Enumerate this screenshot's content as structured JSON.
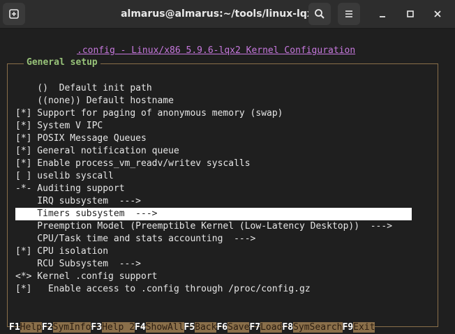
{
  "window": {
    "title": "almarus@almarus:~/tools/linux-lqx"
  },
  "icons": {
    "new_tab": "new-tab-icon",
    "search": "search-icon",
    "menu": "hamburger-menu-icon",
    "minimize": "minimize-icon",
    "maximize": "maximize-icon",
    "close": "close-icon"
  },
  "terminal": {
    "config_title": ".config - Linux/x86 5.9.6-lqx2 Kernel Configuration",
    "section_title": "General setup",
    "menu_items": [
      {
        "text": "    ()  Default init path",
        "selected": false
      },
      {
        "text": "    ((none)) Default hostname",
        "selected": false
      },
      {
        "text": "[*] Support for paging of anonymous memory (swap)",
        "selected": false
      },
      {
        "text": "[*] System V IPC",
        "selected": false
      },
      {
        "text": "[*] POSIX Message Queues",
        "selected": false
      },
      {
        "text": "[*] General notification queue",
        "selected": false
      },
      {
        "text": "[*] Enable process_vm_readv/writev syscalls",
        "selected": false
      },
      {
        "text": "[ ] uselib syscall",
        "selected": false
      },
      {
        "text": "-*- Auditing support",
        "selected": false
      },
      {
        "text": "    IRQ subsystem  --->",
        "selected": false
      },
      {
        "text": "    Timers subsystem  --->",
        "selected": true
      },
      {
        "text": "    Preemption Model (Preemptible Kernel (Low-Latency Desktop))  --->",
        "selected": false
      },
      {
        "text": "    CPU/Task time and stats accounting  --->",
        "selected": false
      },
      {
        "text": "[*] CPU isolation",
        "selected": false
      },
      {
        "text": "    RCU Subsystem  --->",
        "selected": false
      },
      {
        "text": "<*> Kernel .config support",
        "selected": false
      },
      {
        "text": "[*]   Enable access to .config through /proc/config.gz",
        "selected": false
      }
    ],
    "function_keys": [
      {
        "key": "F1",
        "label": "Help"
      },
      {
        "key": "F2",
        "label": "SymInfo"
      },
      {
        "key": "F3",
        "label": "Help 2"
      },
      {
        "key": "F4",
        "label": "ShowAll"
      },
      {
        "key": "F5",
        "label": "Back"
      },
      {
        "key": "F6",
        "label": "Save"
      },
      {
        "key": "F7",
        "label": "Load"
      },
      {
        "key": "F8",
        "label": "SymSearch"
      },
      {
        "key": "F9",
        "label": "Exit"
      }
    ]
  },
  "colors": {
    "title_accent": "#c678dd",
    "section_accent": "#98c379",
    "frame": "#8a6f4a",
    "selection_bg": "#ffffff"
  }
}
